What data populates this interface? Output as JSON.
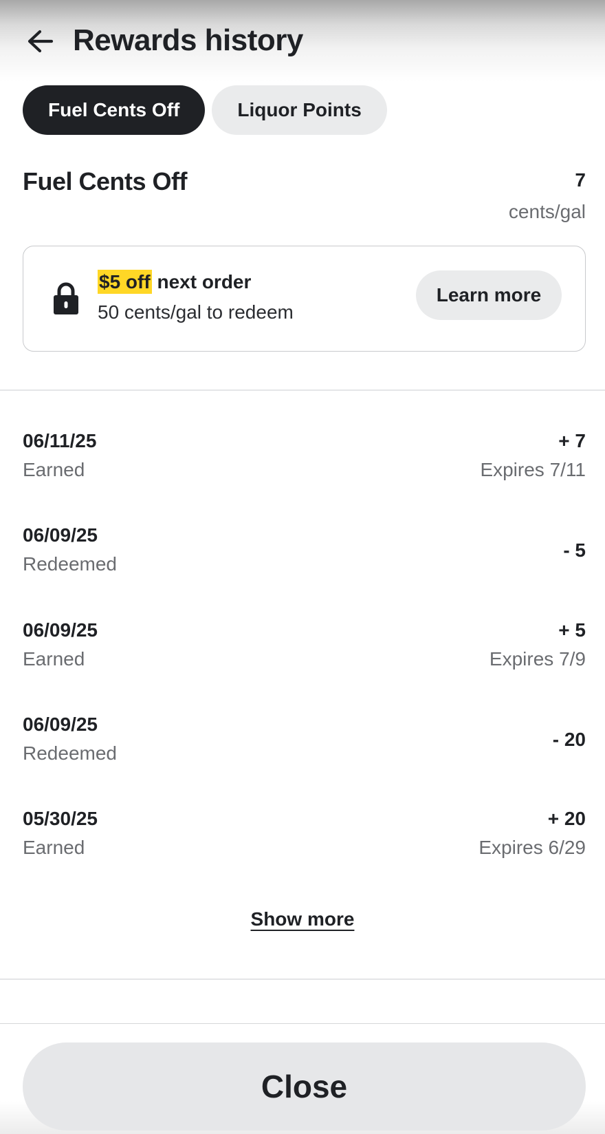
{
  "header": {
    "title": "Rewards history",
    "back_icon": "arrow-left-icon"
  },
  "tabs": [
    {
      "label": "Fuel Cents Off",
      "active": true
    },
    {
      "label": "Liquor Points",
      "active": false
    }
  ],
  "summary": {
    "title": "Fuel Cents Off",
    "balance": "7",
    "unit": "cents/gal"
  },
  "promo": {
    "icon": "lock-icon",
    "highlight": "$5 off",
    "line1_rest": " next order",
    "line2": "50 cents/gal to redeem",
    "button_label": "Learn more",
    "highlight_color": "#ffd726"
  },
  "history": [
    {
      "date": "06/11/25",
      "status": "Earned",
      "amount": "+ 7",
      "expires": "Expires 7/11"
    },
    {
      "date": "06/09/25",
      "status": "Redeemed",
      "amount": "- 5",
      "expires": ""
    },
    {
      "date": "06/09/25",
      "status": "Earned",
      "amount": "+ 5",
      "expires": "Expires 7/9"
    },
    {
      "date": "06/09/25",
      "status": "Redeemed",
      "amount": "- 20",
      "expires": ""
    },
    {
      "date": "05/30/25",
      "status": "Earned",
      "amount": "+ 20",
      "expires": "Expires 6/29"
    }
  ],
  "show_more_label": "Show more",
  "footer": {
    "close_label": "Close"
  },
  "colors": {
    "active_tab": "#1f2125",
    "inactive_tab": "#eaebec",
    "secondary_text": "#6a6c70"
  }
}
